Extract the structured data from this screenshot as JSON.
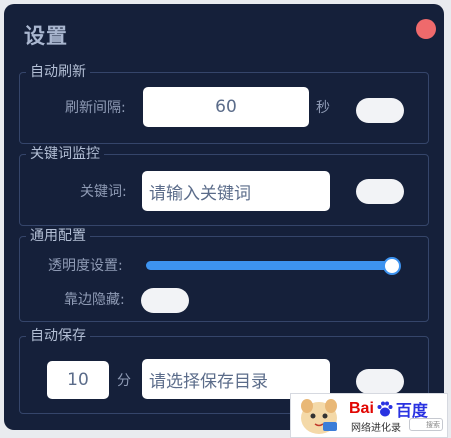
{
  "window": {
    "title": "设置"
  },
  "auto_refresh": {
    "legend": "自动刷新",
    "interval_label": "刷新间隔:",
    "interval_value": "60",
    "unit": "秒",
    "toggle_on": false
  },
  "keyword_monitor": {
    "legend": "关键词监控",
    "label": "关键词:",
    "placeholder": "请输入关键词",
    "toggle_on": false
  },
  "general": {
    "legend": "通用配置",
    "opacity_label": "透明度设置:",
    "opacity_level": 1.0,
    "edge_hide_label": "靠边隐藏:",
    "edge_hide_on": false
  },
  "auto_save": {
    "legend": "自动保存",
    "interval_value": "10",
    "unit": "分",
    "dir_placeholder": "请选择保存目录",
    "toggle_on": false
  },
  "watermark": {
    "brand_left": "Bai",
    "brand_right": "百度",
    "caption": "网络进化录",
    "search_text": "搜索"
  },
  "colors": {
    "window_bg": "#15203a",
    "accent": "#3d93f0",
    "close": "#ef6a6c",
    "baidu_blue": "#2932e1",
    "baidu_red": "#e10602"
  }
}
